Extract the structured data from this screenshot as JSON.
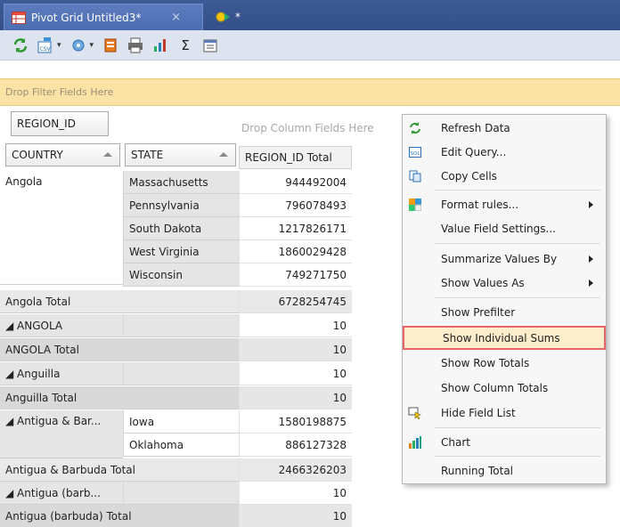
{
  "tabs": [
    {
      "label": "Pivot Grid Untitled3*",
      "close": "×"
    },
    {
      "label": "*"
    }
  ],
  "toolbar": {
    "icons": [
      "refresh-icon",
      "export-csv-icon",
      "options-icon",
      "copy-icon",
      "print-icon",
      "chart-icon",
      "sum-icon",
      "properties-icon"
    ],
    "sum_glyph": "Σ"
  },
  "filter_area": {
    "placeholder": "Drop Filter Fields Here"
  },
  "pivot_header": {
    "region_field": "REGION_ID",
    "drop_column": "Drop Column Fields Here",
    "country_field": "COUNTRY",
    "state_field": "STATE",
    "value_header": "REGION_ID Total"
  },
  "grid": {
    "angola": {
      "country": "Angola",
      "rows": [
        {
          "state": "Massachusetts",
          "value": "944492004"
        },
        {
          "state": "Pennsylvania",
          "value": "796078493"
        },
        {
          "state": "South Dakota",
          "value": "1217826171"
        },
        {
          "state": "West Virginia",
          "value": "1860029428"
        },
        {
          "state": "Wisconsin",
          "value": "749271750"
        }
      ],
      "total_label": "Angola Total",
      "total_value": "6728254745"
    },
    "angola_caps": {
      "country": "◢ ANGOLA",
      "value": "10",
      "total_label": "ANGOLA Total",
      "total_value": "10"
    },
    "anguilla": {
      "country": "◢ Anguilla",
      "value": "10",
      "total_label": "Anguilla Total",
      "total_value": "10"
    },
    "antigua": {
      "country": "◢ Antigua & Bar...",
      "rows": [
        {
          "state": "Iowa",
          "value": "1580198875"
        },
        {
          "state": "Oklahoma",
          "value": "886127328"
        }
      ],
      "total_label": "Antigua & Barbuda Total",
      "total_value": "2466326203"
    },
    "antigua_barb": {
      "country": "◢ Antigua (barb...",
      "value": "10",
      "total_label": "Antigua (barbuda) Total",
      "total_value": "10"
    }
  },
  "context_menu": {
    "items": [
      {
        "label": "Refresh Data",
        "icon": "refresh-icon"
      },
      {
        "label": "Edit Query...",
        "icon": "sql-icon"
      },
      {
        "label": "Copy Cells",
        "icon": "copy-icon"
      },
      {
        "label": "Format rules...",
        "icon": "format-rules-icon",
        "submenu": true
      },
      {
        "label": "Value Field Settings..."
      },
      {
        "label": "Summarize Values By",
        "submenu": true
      },
      {
        "label": "Show Values As",
        "submenu": true
      },
      {
        "label": "Show Prefilter"
      },
      {
        "label": "Show Individual Sums",
        "highlighted": true
      },
      {
        "label": "Show Row Totals"
      },
      {
        "label": "Show Column Totals"
      },
      {
        "label": "Hide Field List",
        "icon": "field-list-icon"
      },
      {
        "label": "Chart",
        "icon": "chart-icon"
      },
      {
        "label": "Running Total"
      }
    ]
  },
  "colors": {
    "tab_bar": "#3b5998",
    "filter_area": "#fbe3a6",
    "highlight_border": "#e8636a",
    "highlight_fill": "#fdeecb"
  }
}
